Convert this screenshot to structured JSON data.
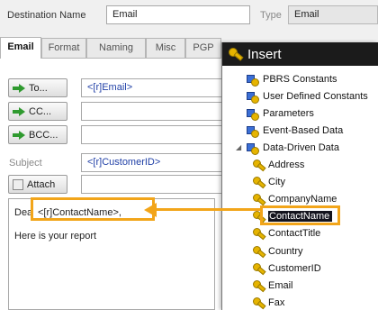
{
  "header": {
    "destination_label": "Destination Name",
    "destination_value": "Email",
    "type_label": "Type",
    "type_value": "Email"
  },
  "tabs": [
    "Email",
    "Format",
    "Naming",
    "Misc",
    "PGP"
  ],
  "email_form": {
    "to_button": "To...",
    "to_value": "<[r]Email>",
    "cc_button": "CC...",
    "cc_value": "",
    "bcc_button": "BCC...",
    "bcc_value": "",
    "subject_label": "Subject",
    "subject_value": "<[r]CustomerID>",
    "attach_button": "Attach",
    "attach_value": "",
    "body_prefix": "Dea",
    "body_insert": "<[r]ContactName>,",
    "body_line2": "Here is your report"
  },
  "insert_popup": {
    "title": "Insert",
    "items": [
      {
        "label": "PBRS Constants",
        "level": 0,
        "icon": "data-source-icon"
      },
      {
        "label": "User Defined Constants",
        "level": 0,
        "icon": "data-source-icon"
      },
      {
        "label": "Parameters",
        "level": 0,
        "icon": "data-source-icon"
      },
      {
        "label": "Event-Based Data",
        "level": 0,
        "icon": "data-source-icon"
      },
      {
        "label": "Data-Driven Data",
        "level": 0,
        "icon": "data-source-icon",
        "expanded": true
      },
      {
        "label": "Address",
        "level": 1,
        "icon": "key-icon"
      },
      {
        "label": "City",
        "level": 1,
        "icon": "key-icon"
      },
      {
        "label": "CompanyName",
        "level": 1,
        "icon": "key-icon"
      },
      {
        "label": "ContactName",
        "level": 1,
        "icon": "key-icon",
        "selected": true
      },
      {
        "label": "ContactTitle",
        "level": 1,
        "icon": "key-icon"
      },
      {
        "label": "Country",
        "level": 1,
        "icon": "key-icon"
      },
      {
        "label": "CustomerID",
        "level": 1,
        "icon": "key-icon"
      },
      {
        "label": "Email",
        "level": 1,
        "icon": "key-icon"
      },
      {
        "label": "Fax",
        "level": 1,
        "icon": "key-icon"
      }
    ]
  },
  "colors": {
    "callout": "#f2a51a",
    "popup_header": "#1b1b1b",
    "field_text_blue": "#1f3fa6"
  }
}
